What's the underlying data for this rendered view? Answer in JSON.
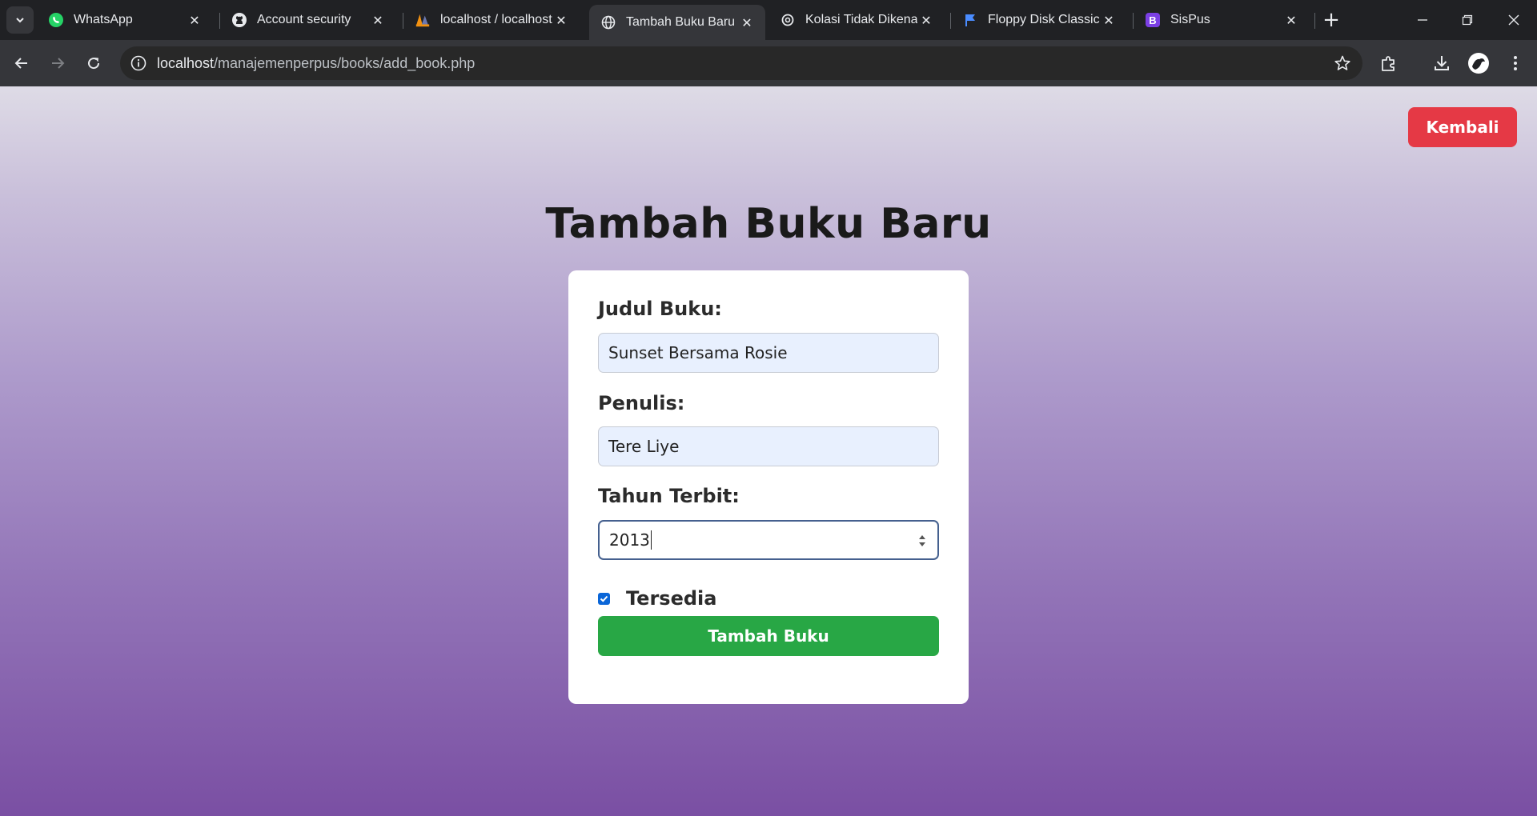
{
  "browser": {
    "tabs": [
      {
        "title": "WhatsApp",
        "icon": "whatsapp-icon",
        "active": false
      },
      {
        "title": "Account security",
        "icon": "github-icon",
        "active": false
      },
      {
        "title": "localhost / localhost / ",
        "icon": "phpmyadmin-icon",
        "active": false
      },
      {
        "title": "Tambah Buku Baru",
        "icon": "globe-icon",
        "active": true
      },
      {
        "title": "Kolasi Tidak Dikenal ",
        "icon": "openai-icon",
        "active": false
      },
      {
        "title": "Floppy Disk Classic Li",
        "icon": "flag-icon",
        "active": false
      },
      {
        "title": "SisPus",
        "icon": "bootstrap-icon",
        "active": false
      }
    ],
    "close_glyph": "✕",
    "new_tab_glyph": "+",
    "url_host": "localhost",
    "url_path": "/manajemenperpus/books/add_book.php"
  },
  "page": {
    "back_label": "Kembali",
    "title": "Tambah Buku Baru",
    "form": {
      "judul_label": "Judul Buku:",
      "judul_value": "Sunset Bersama Rosie",
      "penulis_label": "Penulis:",
      "penulis_value": "Tere Liye",
      "tahun_label": "Tahun Terbit:",
      "tahun_value": "2013",
      "tersedia_label": "Tersedia",
      "tersedia_checked": true,
      "submit_label": "Tambah Buku"
    }
  },
  "colors": {
    "back_button": "#e53945",
    "submit_button": "#28a745",
    "checkbox": "#0a66d8"
  }
}
